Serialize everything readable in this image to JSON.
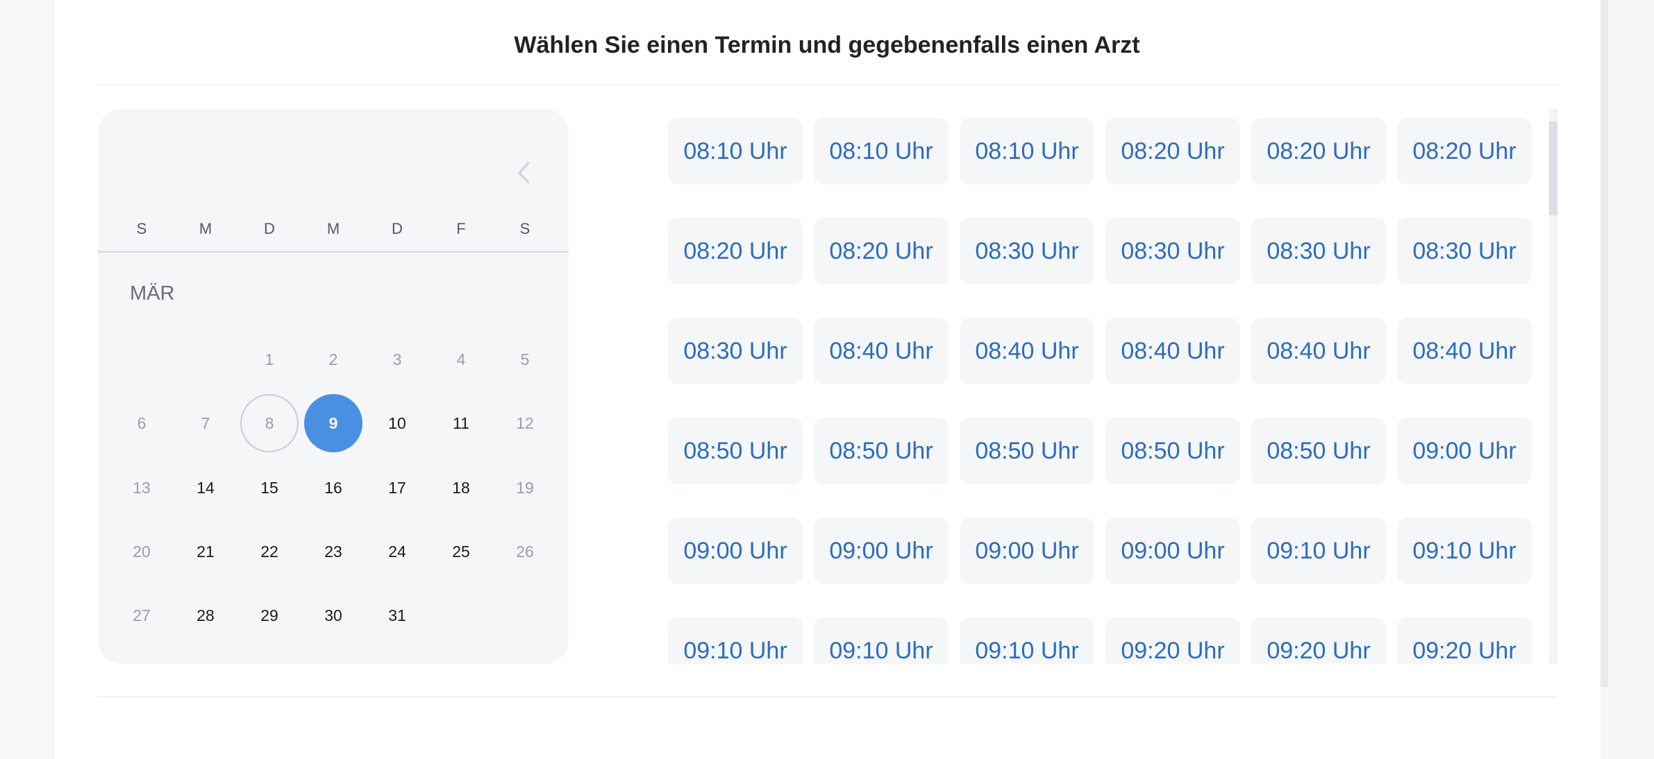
{
  "header": {
    "title": "Wählen Sie einen Termin und gegebenenfalls einen Arzt"
  },
  "calendar": {
    "weekdays": [
      "S",
      "M",
      "D",
      "M",
      "D",
      "F",
      "S"
    ],
    "month": "MÄR",
    "prev_icon": "chevron-left-icon",
    "next_icon": "chevron-right-icon",
    "weeks": [
      [
        null,
        null,
        {
          "label": "1",
          "state": "muted"
        },
        {
          "label": "2",
          "state": "muted"
        },
        {
          "label": "3",
          "state": "muted"
        },
        {
          "label": "4",
          "state": "muted"
        },
        {
          "label": "5",
          "state": "muted"
        }
      ],
      [
        {
          "label": "6",
          "state": "muted"
        },
        {
          "label": "7",
          "state": "muted"
        },
        {
          "label": "8",
          "state": "today"
        },
        {
          "label": "9",
          "state": "selected"
        },
        {
          "label": "10",
          "state": "available"
        },
        {
          "label": "11",
          "state": "available"
        },
        {
          "label": "12",
          "state": "muted"
        }
      ],
      [
        {
          "label": "13",
          "state": "muted"
        },
        {
          "label": "14",
          "state": "available"
        },
        {
          "label": "15",
          "state": "available"
        },
        {
          "label": "16",
          "state": "available"
        },
        {
          "label": "17",
          "state": "available"
        },
        {
          "label": "18",
          "state": "available"
        },
        {
          "label": "19",
          "state": "muted"
        }
      ],
      [
        {
          "label": "20",
          "state": "muted"
        },
        {
          "label": "21",
          "state": "available"
        },
        {
          "label": "22",
          "state": "available"
        },
        {
          "label": "23",
          "state": "available"
        },
        {
          "label": "24",
          "state": "available"
        },
        {
          "label": "25",
          "state": "available"
        },
        {
          "label": "26",
          "state": "muted"
        }
      ],
      [
        {
          "label": "27",
          "state": "muted"
        },
        {
          "label": "28",
          "state": "available"
        },
        {
          "label": "29",
          "state": "available"
        },
        {
          "label": "30",
          "state": "available"
        },
        {
          "label": "31",
          "state": "available"
        },
        null,
        null
      ]
    ]
  },
  "slots": [
    "08:10 Uhr",
    "08:10 Uhr",
    "08:10 Uhr",
    "08:20 Uhr",
    "08:20 Uhr",
    "08:20 Uhr",
    "08:20 Uhr",
    "08:20 Uhr",
    "08:30 Uhr",
    "08:30 Uhr",
    "08:30 Uhr",
    "08:30 Uhr",
    "08:30 Uhr",
    "08:40 Uhr",
    "08:40 Uhr",
    "08:40 Uhr",
    "08:40 Uhr",
    "08:40 Uhr",
    "08:50 Uhr",
    "08:50 Uhr",
    "08:50 Uhr",
    "08:50 Uhr",
    "08:50 Uhr",
    "09:00 Uhr",
    "09:00 Uhr",
    "09:00 Uhr",
    "09:00 Uhr",
    "09:00 Uhr",
    "09:10 Uhr",
    "09:10 Uhr",
    "09:10 Uhr",
    "09:10 Uhr",
    "09:10 Uhr",
    "09:20 Uhr",
    "09:20 Uhr",
    "09:20 Uhr"
  ],
  "colors": {
    "accent": "#4a90e2",
    "slot_text": "#2b6dbd"
  }
}
